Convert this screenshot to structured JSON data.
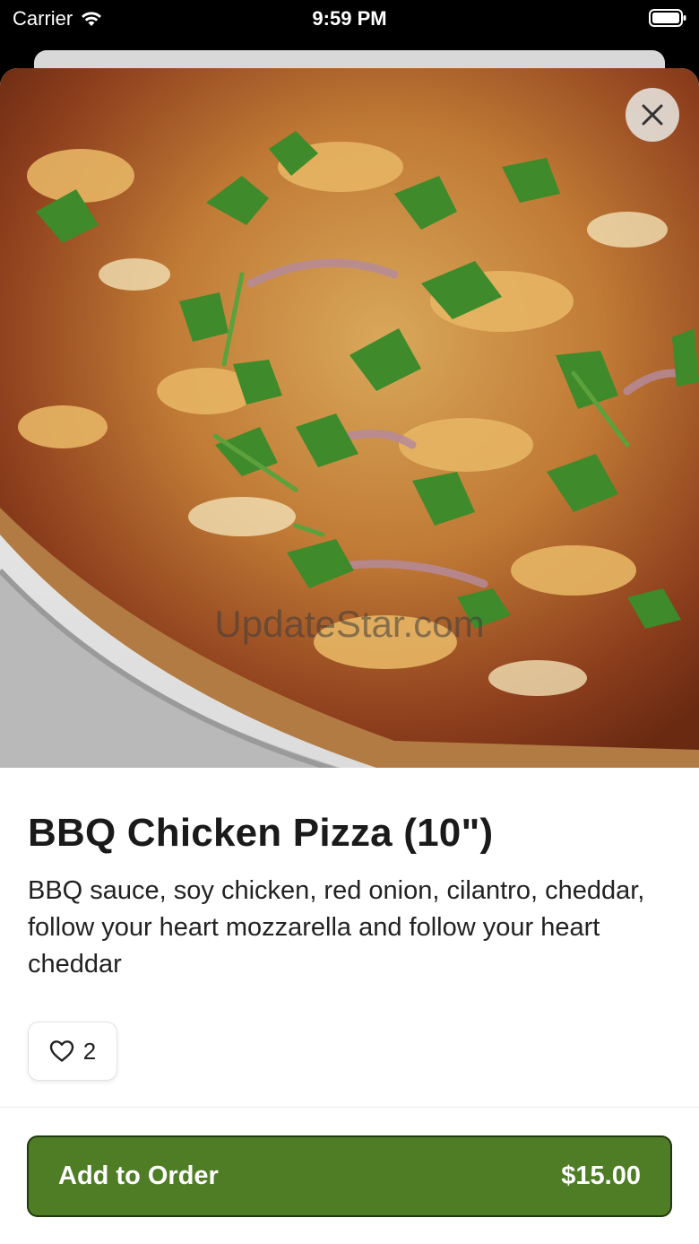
{
  "status_bar": {
    "carrier": "Carrier",
    "time": "9:59 PM"
  },
  "hero": {
    "watermark": "UpdateStar.com"
  },
  "item": {
    "title": "BBQ Chicken Pizza (10\")",
    "description": "BBQ sauce, soy chicken, red onion, cilantro, cheddar, follow your heart mozzarella and follow your heart cheddar",
    "likes": "2"
  },
  "order_button": {
    "label": "Add to Order",
    "price": "$15.00"
  },
  "colors": {
    "accent": "#4e7d25",
    "accent_border": "#1f3a0d"
  },
  "icons": {
    "close": "close-icon",
    "like": "heart-icon",
    "wifi": "wifi-icon",
    "battery": "battery-icon"
  }
}
